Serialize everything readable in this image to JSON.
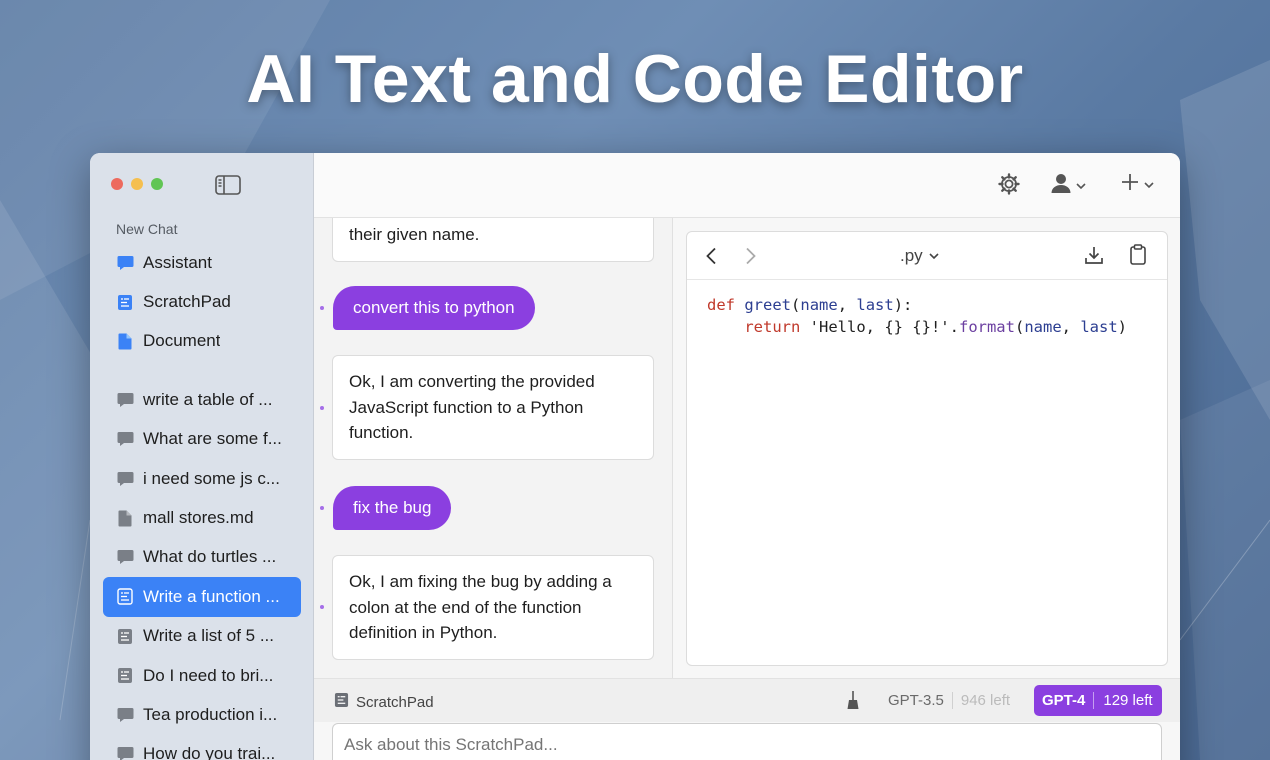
{
  "hero": {
    "title": "AI Text and Code Editor"
  },
  "sidebar": {
    "section_label": "New Chat",
    "primary": [
      {
        "label": "Assistant",
        "icon": "chat-bubble-icon",
        "color": "#3b82f6"
      },
      {
        "label": "ScratchPad",
        "icon": "scratchpad-icon",
        "color": "#3b82f6"
      },
      {
        "label": "Document",
        "icon": "document-icon",
        "color": "#3b82f6"
      }
    ],
    "history": [
      {
        "label": "write a table of ...",
        "icon": "chat-bubble-icon"
      },
      {
        "label": "What are some f...",
        "icon": "chat-bubble-icon"
      },
      {
        "label": "i need some js c...",
        "icon": "chat-bubble-icon"
      },
      {
        "label": "mall stores.md",
        "icon": "document-icon"
      },
      {
        "label": "What do turtles ...",
        "icon": "chat-bubble-icon"
      },
      {
        "label": "Write a function ...",
        "icon": "scratchpad-icon",
        "active": true
      },
      {
        "label": "Write a list of 5 ...",
        "icon": "scratchpad-icon"
      },
      {
        "label": "Do I need to bri...",
        "icon": "scratchpad-icon"
      },
      {
        "label": "Tea production i...",
        "icon": "chat-bubble-icon"
      },
      {
        "label": "How do you trai...",
        "icon": "chat-bubble-icon"
      }
    ]
  },
  "chat": {
    "messages": [
      {
        "role": "assistant",
        "text": "their given name."
      },
      {
        "role": "user",
        "text": "convert this to python"
      },
      {
        "role": "assistant",
        "text": "Ok, I am converting the provided JavaScript function to a Python function."
      },
      {
        "role": "user",
        "text": "fix the bug"
      },
      {
        "role": "assistant",
        "text": "Ok, I am fixing the bug by adding a colon at the end of the function definition in Python."
      }
    ]
  },
  "code": {
    "language": ".py",
    "line1": {
      "kw": "def",
      "fn": "greet",
      "open": "(",
      "p1": "name",
      "sep": ", ",
      "p2": "last",
      "close": "):"
    },
    "line2": {
      "indent": "    ",
      "kw": "return",
      "str": " 'Hello, {} {}!'",
      "dot": ".",
      "mth": "format",
      "open": "(",
      "p1": "name",
      "sep": ", ",
      "p2": "last",
      "close": ")"
    }
  },
  "status": {
    "mode": "ScratchPad",
    "gpt35": {
      "label": "GPT-3.5",
      "left": "946 left"
    },
    "gpt4": {
      "label": "GPT-4",
      "left": "129 left"
    }
  },
  "input": {
    "placeholder": "Ask about this ScratchPad..."
  },
  "colors": {
    "accent": "#8b3fe0",
    "active": "#3b82f6"
  }
}
